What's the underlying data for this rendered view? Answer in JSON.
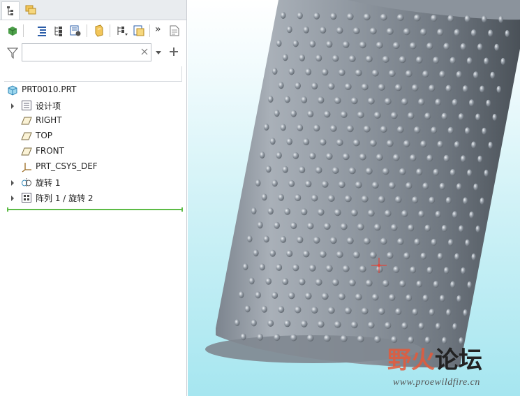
{
  "model_tree": {
    "tabs": [
      {
        "name": "model-tree-tab",
        "active": true
      },
      {
        "name": "folder-browser-tab",
        "active": false
      }
    ],
    "search": {
      "placeholder": "",
      "value": ""
    },
    "root": {
      "label": "PRT0010.PRT"
    },
    "items": [
      {
        "label": "设计项",
        "icon": "design-items-icon",
        "expandable": true
      },
      {
        "label": "RIGHT",
        "icon": "datum-plane-icon",
        "expandable": false
      },
      {
        "label": "TOP",
        "icon": "datum-plane-icon",
        "expandable": false
      },
      {
        "label": "FRONT",
        "icon": "datum-plane-icon",
        "expandable": false
      },
      {
        "label": "PRT_CSYS_DEF",
        "icon": "coordinate-system-icon",
        "expandable": false
      },
      {
        "label": "旋转 1",
        "icon": "revolve-feature-icon",
        "expandable": true
      },
      {
        "label": "阵列 1 / 旋转 2",
        "icon": "pattern-feature-icon",
        "expandable": true
      }
    ]
  },
  "toolbar": {
    "more_glyph": "»"
  },
  "watermark": {
    "brand_part1": "野火",
    "brand_part2": "论坛",
    "url": "www.proewildfire.cn"
  },
  "colors": {
    "insert_indicator": "#5dbb46",
    "model_surface": "#8a949e",
    "spin_center": "#e0453a"
  }
}
